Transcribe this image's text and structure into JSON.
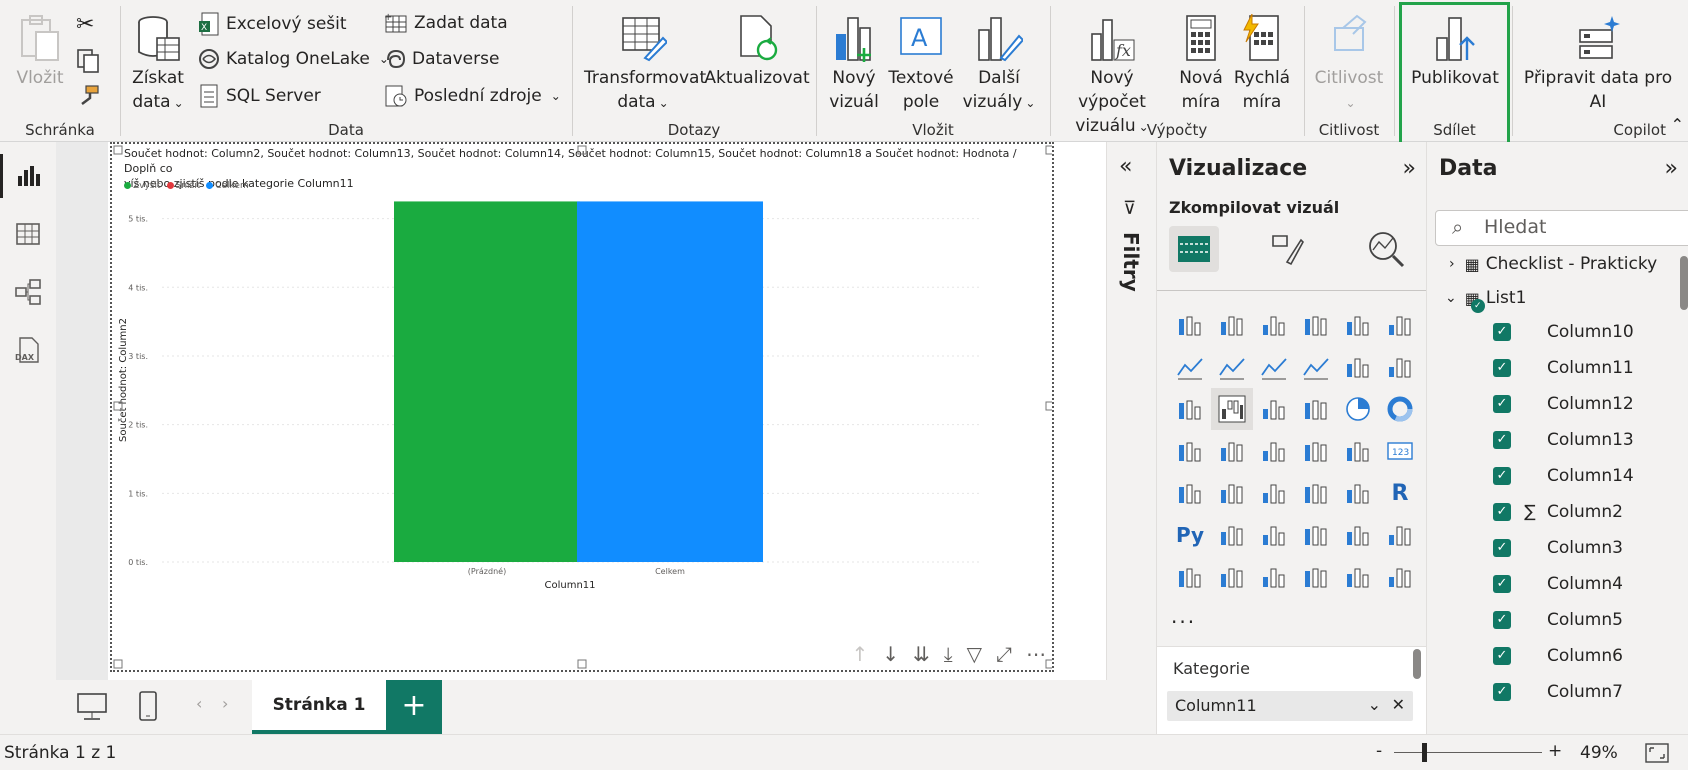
{
  "ribbon": {
    "groups": {
      "clipboard": "Schránka",
      "data": "Data",
      "queries": "Dotazy",
      "insert": "Vložit",
      "calculations": "Výpočty",
      "sensitivity": "Citlivost",
      "share": "Sdílet",
      "copilot": "Copilot"
    },
    "paste": "Vložit",
    "get_data_line1": "Získat",
    "get_data_line2": "data",
    "excel": "Excelový sešit",
    "onelake": "Katalog OneLake",
    "sql": "SQL Server",
    "enter_data": "Zadat data",
    "dataverse": "Dataverse",
    "recent": "Poslední zdroje",
    "transform_line1": "Transformovat",
    "transform_line2": "data",
    "refresh": "Aktualizovat",
    "new_visual_line1": "Nový",
    "new_visual_line2": "vizuál",
    "textbox_line1": "Textové",
    "textbox_line2": "pole",
    "more_visuals_line1": "Další",
    "more_visuals_line2": "vizuály",
    "new_calc_line1": "Nový výpočet",
    "new_calc_line2": "vizuálu",
    "new_measure_line1": "Nová",
    "new_measure_line2": "míra",
    "quick_measure_line1": "Rychlá",
    "quick_measure_line2": "míra",
    "sensitivity": "Citlivost",
    "publish": "Publikovat",
    "prep_ai_line1": "Připravit data pro",
    "prep_ai_line2": "AI"
  },
  "visual": {
    "title_line1": "Součet hodnot: Column2, Součet hodnot: Column13, Součet hodnot: Column14, Součet hodnot: Column15, Součet hodnot: Column18 a Součet hodnot: Hodnota / Doplň co",
    "title_line2": "víš nebo zjistíš podle kategorie Column11",
    "legend": [
      "Zvýšit",
      "Snížit",
      "Celkem"
    ]
  },
  "chart_data": {
    "type": "bar",
    "chart_subtype": "waterfall",
    "categories": [
      "(Prázdné)",
      "Celkem"
    ],
    "values": [
      5250,
      5250
    ],
    "colors": [
      "#1aab40",
      "#118dff"
    ],
    "xlabel": "Column11",
    "ylabel": "Součet hodnot: Column2",
    "yticks": [
      "0 tis.",
      "1 tis.",
      "2 tis.",
      "3 tis.",
      "4 tis.",
      "5 tis."
    ],
    "ytick_values": [
      0,
      1000,
      2000,
      3000,
      4000,
      5000
    ],
    "ylim": [
      0,
      5300
    ],
    "grid": true,
    "legend_position": "top-left"
  },
  "filters": {
    "label": "Filtry"
  },
  "viz_pane": {
    "title": "Vizualizace",
    "subtitle": "Zkompilovat vizuál",
    "more": "...",
    "category_label": "Kategorie",
    "category_field": "Column11"
  },
  "data_pane": {
    "title": "Data",
    "search_placeholder": "Hledat",
    "table_above": "Checklist - Prakticky",
    "table": "List1",
    "fields": [
      "Column10",
      "Column11",
      "Column12",
      "Column13",
      "Column14",
      "Column2",
      "Column3",
      "Column4",
      "Column5",
      "Column6",
      "Column7"
    ]
  },
  "tabs": {
    "page1": "Stránka 1",
    "add": "+"
  },
  "status": {
    "page_info": "Stránka 1 z 1",
    "zoom": "49%",
    "minus": "-",
    "plus": "+"
  }
}
